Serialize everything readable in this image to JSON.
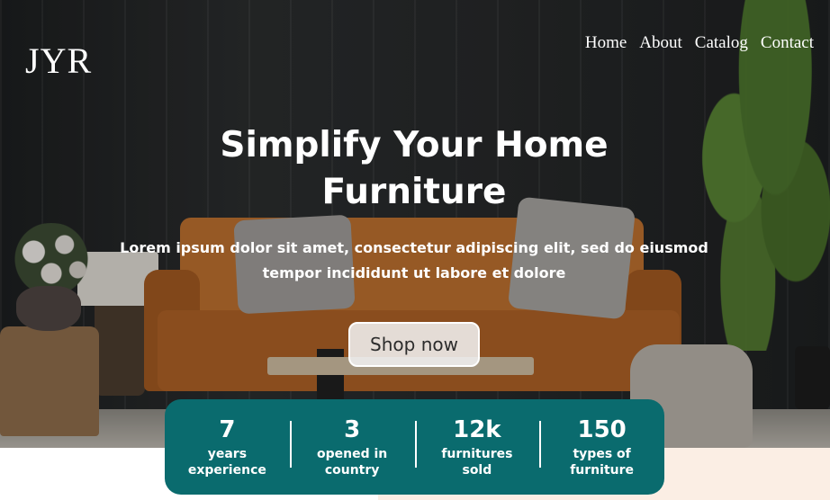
{
  "brand": {
    "logo": "JYR"
  },
  "nav": {
    "items": [
      "Home",
      "About",
      "Catalog",
      "Contact"
    ]
  },
  "hero": {
    "headline_line1": "Simplify Your Home",
    "headline_line2": "Furniture",
    "subtext_line1": "Lorem ipsum dolor sit amet, consectetur adipiscing elit, sed do eiusmod",
    "subtext_line2": "tempor incididunt ut labore et dolore",
    "cta_label": "Shop now"
  },
  "stats": [
    {
      "value": "7",
      "label_line1": "years",
      "label_line2": "experience"
    },
    {
      "value": "3",
      "label_line1": "opened in",
      "label_line2": "country"
    },
    {
      "value": "12k",
      "label_line1": "furnitures",
      "label_line2": "sold"
    },
    {
      "value": "150",
      "label_line1": "types of",
      "label_line2": "furniture"
    }
  ],
  "colors": {
    "accent": "#0a6b6e",
    "button_bg": "#f0f0f0",
    "text_light": "#ffffff",
    "below_tint": "#fbeee4"
  }
}
